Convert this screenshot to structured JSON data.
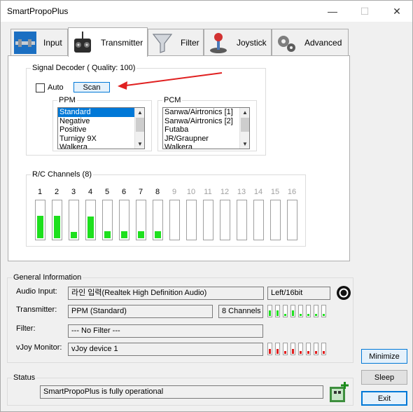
{
  "window": {
    "title": "SmartPropoPlus",
    "minimize_glyph": "—",
    "maximize_glyph": "☐",
    "close_glyph": "✕"
  },
  "tabs": [
    {
      "label": "Input",
      "icon": "cable-plug-icon"
    },
    {
      "label": "Transmitter",
      "icon": "rc-transmitter-icon"
    },
    {
      "label": "Filter",
      "icon": "funnel-icon"
    },
    {
      "label": "Joystick",
      "icon": "joystick-icon"
    },
    {
      "label": "Advanced",
      "icon": "gears-icon"
    }
  ],
  "signal_decoder": {
    "label": "Signal Decoder ( Quality: 100)",
    "auto_label": "Auto",
    "auto_checked": false,
    "scan_label": "Scan",
    "ppm_label": "PPM",
    "ppm_items": [
      "Standard",
      "Negative",
      "Positive",
      "Turnigy 9X",
      "Walkera"
    ],
    "ppm_selected": 0,
    "pcm_label": "PCM",
    "pcm_items": [
      "Sanwa/Airtronics [1]",
      "Sanwa/Airtronics [2]",
      "Futaba",
      "JR/Graupner",
      "Walkera"
    ]
  },
  "rc_channels": {
    "label": "R/C Channels (8)",
    "channels": [
      {
        "label": "1",
        "level": 0.6,
        "active": true
      },
      {
        "label": "2",
        "level": 0.6,
        "active": true
      },
      {
        "label": "3",
        "level": 0.17,
        "active": true
      },
      {
        "label": "4",
        "level": 0.57,
        "active": true
      },
      {
        "label": "5",
        "level": 0.19,
        "active": true
      },
      {
        "label": "6",
        "level": 0.19,
        "active": true
      },
      {
        "label": "7",
        "level": 0.19,
        "active": true
      },
      {
        "label": "8",
        "level": 0.19,
        "active": true
      },
      {
        "label": "9",
        "level": 0,
        "active": false
      },
      {
        "label": "10",
        "level": 0,
        "active": false
      },
      {
        "label": "11",
        "level": 0,
        "active": false
      },
      {
        "label": "12",
        "level": 0,
        "active": false
      },
      {
        "label": "13",
        "level": 0,
        "active": false
      },
      {
        "label": "14",
        "level": 0,
        "active": false
      },
      {
        "label": "15",
        "level": 0,
        "active": false
      },
      {
        "label": "16",
        "level": 0,
        "active": false
      }
    ]
  },
  "general_info": {
    "label": "General Information",
    "audio_input_label": "Audio Input:",
    "audio_input_value": "라인 입력(Realtek High Definition Audio)",
    "audio_format": "Left/16bit",
    "transmitter_label": "Transmitter:",
    "transmitter_value": "PPM (Standard)",
    "channels_value": "8 Channels",
    "filter_label": "Filter:",
    "filter_value": "--- No Filter ---",
    "vjoy_label": "vJoy Monitor:",
    "vjoy_value": "vJoy device 1",
    "transmitter_levels": [
      0.6,
      0.6,
      0.2,
      0.6,
      0.2,
      0.2,
      0.2,
      0.2
    ],
    "vjoy_levels": [
      0.5,
      0.5,
      0.3,
      0.5,
      0.3,
      0.3,
      0.3,
      0.3
    ],
    "green": "#1ee01e",
    "red": "#e01e1e"
  },
  "status": {
    "label": "Status",
    "text": "SmartPropoPlus is fully operational"
  },
  "buttons": {
    "minimize": "Minimize",
    "sleep": "Sleep",
    "exit": "Exit"
  }
}
